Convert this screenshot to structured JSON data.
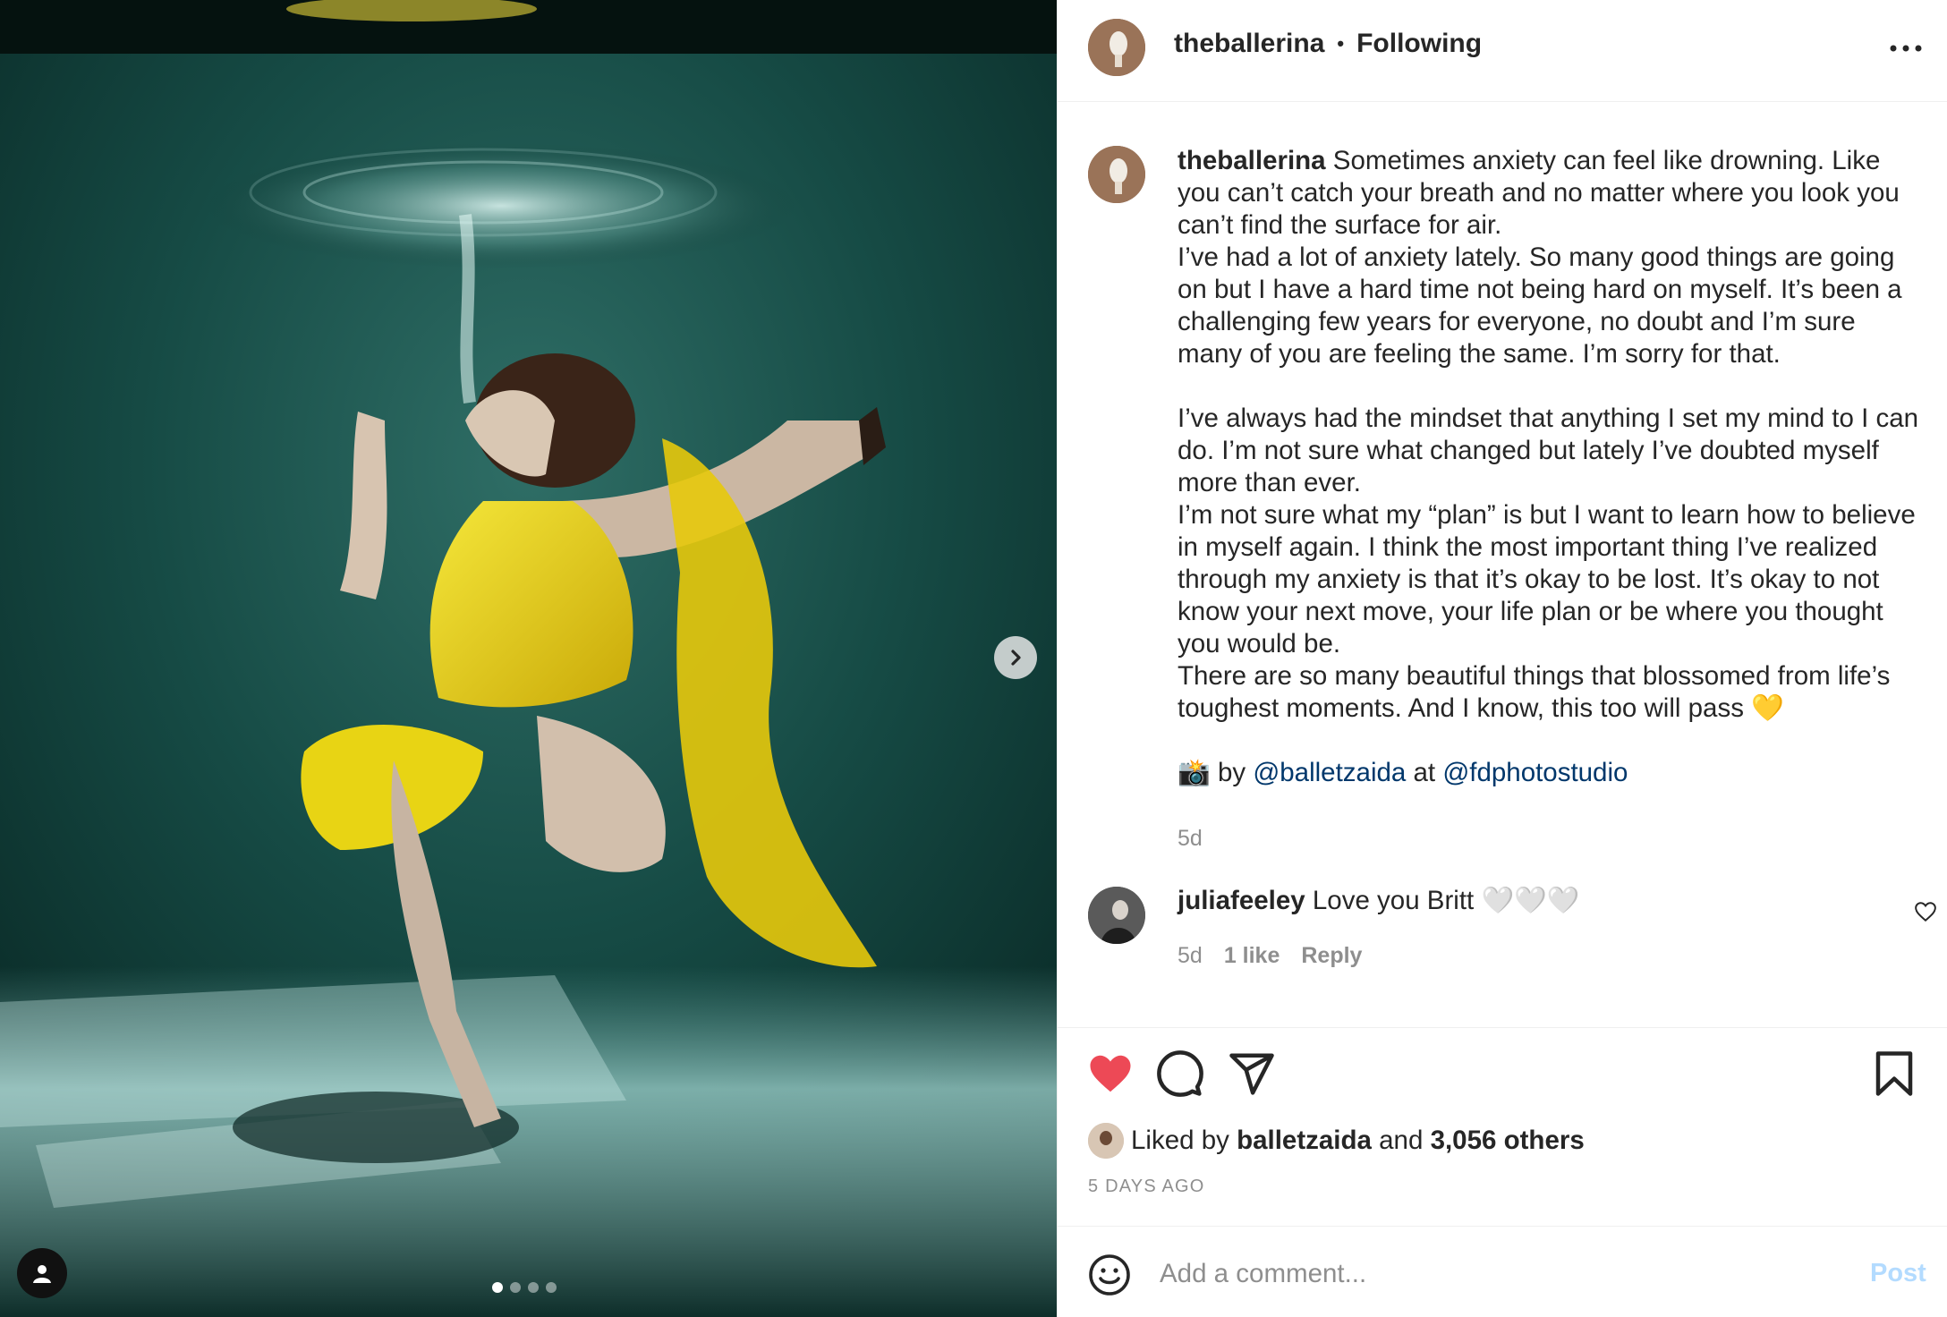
{
  "post": {
    "username": "theballerina",
    "separator": "•",
    "follow_state": "Following",
    "more_icon": "more-horizontal-icon",
    "carousel": {
      "slide_count": 4,
      "active_slide": 1
    }
  },
  "caption": {
    "username": "theballerina",
    "paragraph1": "Sometimes anxiety can feel like drowning. Like you can’t catch your breath and no matter where you look you can’t find the surface for air.\nI’ve had a lot of anxiety lately. So many good things are going on but I have a hard time not being hard on myself. It’s been a challenging few years for everyone, no doubt and I’m sure many of you are feeling the same. I’m sorry for that.\n\nI’ve always had the mindset that anything I set my mind to I can do. I’m not sure what changed but lately I’ve doubted myself more than ever.\nI’m not sure what my “plan” is but I want to learn how to believe in myself again. I think the most important thing I’ve realized through my anxiety is that it’s okay to be lost. It’s okay to not know your next move, your life plan or be where you thought you would be.\nThere are so many beautiful things that blossomed from life’s toughest moments. And I know, this too will pass 💛",
    "credit_emoji": "📸",
    "credit_by": "by",
    "photographer": "@balletzaida",
    "credit_at": "at",
    "studio": "@fdphotostudio",
    "time": "5d"
  },
  "comment": {
    "username": "juliafeeley",
    "text": "Love you Britt 🤍🤍🤍",
    "time": "5d",
    "likes": "1 like",
    "reply": "Reply"
  },
  "actions": {
    "liked": true,
    "like_color": "#ed4956",
    "liked_by_prefix": "Liked by",
    "liked_by_user": "balletzaida",
    "liked_by_and": "and",
    "others": "3,056 others",
    "date": "5 DAYS AGO"
  },
  "add_comment": {
    "placeholder": "Add a comment...",
    "post_label": "Post",
    "post_color": "#b3dbff"
  }
}
